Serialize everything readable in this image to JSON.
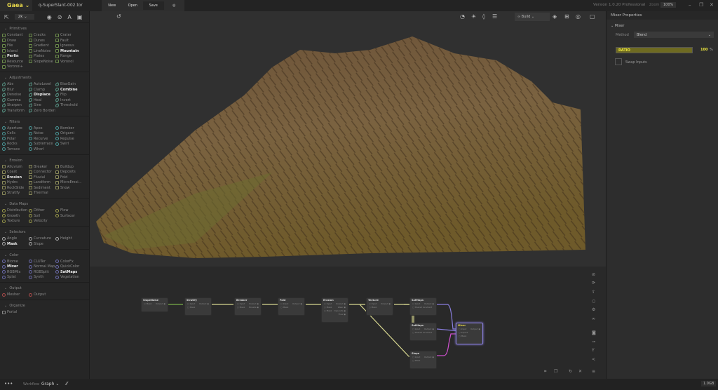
{
  "app": {
    "logo": "Gaea",
    "file": "q-SuperSlant-002.tor",
    "new": "New",
    "open": "Open",
    "save": "Save",
    "version": "Version 1.0.20 Professional",
    "zoom_label": "Zoom",
    "zoom_value": "100%"
  },
  "left": {
    "resolution": "2k",
    "sections": [
      {
        "title": "Primitives",
        "shape": "sq",
        "color": "#6a8a4a",
        "items": [
          "Constant",
          "Cracks",
          "Crater",
          "Draw",
          "Dunes",
          "Fault",
          "File",
          "Gradient",
          "Igneous",
          "Island",
          "LineNoise",
          "Mountain",
          "Perlin",
          "Plates",
          "Range",
          "Resource",
          "SlopeNoise",
          "Voronoi",
          "Voronoi+"
        ],
        "bold": [
          "Mountain",
          "Perlin"
        ]
      },
      {
        "title": "Adjustments",
        "shape": "lf",
        "color": "#5a9a8a",
        "items": [
          "Abs",
          "AutoLevel",
          "BiasGain",
          "Blur",
          "Clamp",
          "Combine",
          "Denoise",
          "Displace",
          "Flip",
          "Gamma",
          "Heal",
          "Invert",
          "Sharpen",
          "Sine",
          "Threshold",
          "Transform",
          "Zero Borders"
        ],
        "bold": [
          "Combine",
          "Displace"
        ]
      },
      {
        "title": "Filters",
        "shape": "ci",
        "color": "#4a9a9a",
        "items": [
          "Aperture",
          "Apex",
          "Bomber",
          "Cells",
          "Noise",
          "Origami",
          "Polar",
          "Recurve",
          "Repulse",
          "Rocks",
          "Subterrace",
          "Swirl",
          "Terrace",
          "Whorl"
        ],
        "bold": []
      },
      {
        "title": "Erosion",
        "shape": "sq",
        "color": "#8a8a5a",
        "items": [
          "Alluvium",
          "Breaker",
          "Buildup",
          "Coast",
          "Connector",
          "Deposits",
          "Erosion",
          "Fluvial",
          "Fold",
          "Hydro",
          "Landform",
          "MicroErosi...",
          "RockSlide",
          "Sediment",
          "Snow",
          "Stratify",
          "Thermal"
        ],
        "bold": [
          "Erosion"
        ]
      },
      {
        "title": "Data Maps",
        "shape": "ci",
        "color": "#9a9a4a",
        "items": [
          "Distribution",
          "Dither",
          "Flow",
          "Growth",
          "Soil",
          "Surfacer",
          "Texture",
          "Velocity"
        ],
        "bold": []
      },
      {
        "title": "Selectors",
        "shape": "ci",
        "color": "#aaaaaa",
        "items": [
          "Angle",
          "Curvature",
          "Height",
          "Mask",
          "Slope"
        ],
        "bold": [
          "Mask"
        ]
      },
      {
        "title": "Color",
        "shape": "ci",
        "color": "#6a6aaa",
        "items": [
          "Biome",
          "CLUTer",
          "ColorFx",
          "Mixer",
          "Normal Map",
          "QuickColor",
          "RGBMix",
          "RGBSplit",
          "SatMaps",
          "Splat",
          "Synth",
          "Vegetation"
        ],
        "bold": [
          "Mixer",
          "SatMaps"
        ]
      },
      {
        "title": "Output",
        "shape": "ci",
        "color": "#aa4a4a",
        "items": [
          "Mesher",
          "Output"
        ],
        "bold": []
      },
      {
        "title": "Organize",
        "shape": "sq",
        "color": "#888888",
        "items": [
          "Portal"
        ],
        "bold": []
      }
    ]
  },
  "toolbar": {
    "build": "Build"
  },
  "right": {
    "title": "Mixer Properties",
    "section": "Mixer",
    "method_label": "Method",
    "method_value": "Blend",
    "ratio_label": "RATIO",
    "ratio_value": "100",
    "ratio_unit": "%",
    "swap_label": "Swap Inputs"
  },
  "graph": {
    "nodes": [
      {
        "title": "SlopeNoise",
        "in": [
          "Mask"
        ],
        "out": [
          "Output"
        ]
      },
      {
        "title": "Stratify",
        "in": [
          "Input",
          "Mask"
        ],
        "out": [
          "Output"
        ]
      },
      {
        "title": "Breaker",
        "in": [
          "Input",
          "Mask"
        ],
        "out": [
          "Output",
          "Breaks"
        ]
      },
      {
        "title": "Fold",
        "in": [
          "Input",
          "Mask"
        ],
        "out": [
          "Output"
        ]
      },
      {
        "title": "Erosion",
        "in": [
          "Input",
          "Mask",
          "Mask"
        ],
        "out": [
          "Output",
          "Wear",
          "Deposits",
          "Flow"
        ]
      },
      {
        "title": "Texture",
        "in": [
          "Input",
          "Mask"
        ],
        "out": [
          "Output"
        ]
      },
      {
        "title": "SatMaps",
        "in": [
          "Input",
          "Shared Gradient"
        ],
        "out": [
          "Output"
        ]
      },
      {
        "title": "SatMaps",
        "in": [
          "Input",
          "Shared Gradient"
        ],
        "out": [
          "Output"
        ]
      },
      {
        "title": "Slope",
        "in": [
          "Input",
          "Mask"
        ],
        "out": [
          "Output"
        ]
      },
      {
        "title": "Mixer",
        "in": [
          "Input",
          "Input2",
          "Mask"
        ],
        "out": [
          "Output"
        ]
      }
    ]
  },
  "bottom": {
    "workflow_label": "Workflow",
    "workflow_value": "Graph",
    "memory": "1.0GB"
  }
}
